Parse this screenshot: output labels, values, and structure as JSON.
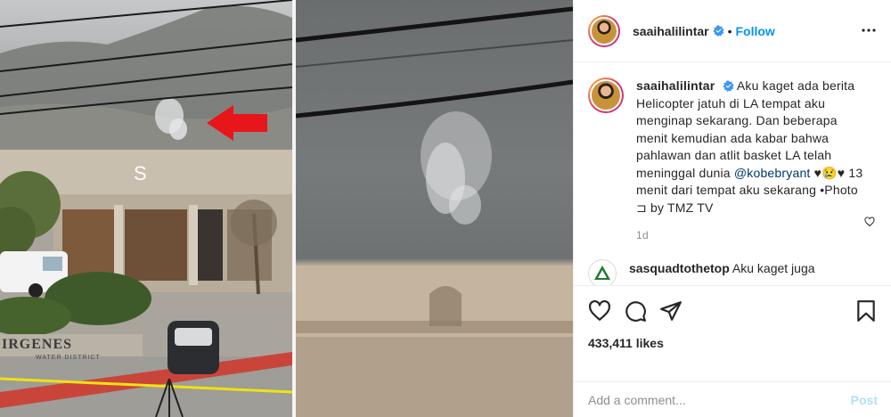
{
  "post": {
    "author": "saaihalilintar",
    "follow_label": "Follow",
    "separator": "•",
    "caption_parts": {
      "text1": "Aku kaget ada berita Helicopter jatuh di LA tempat aku menginap sekarang. Dan beberapa menit kemudian ada kabar bahwa pahlawan dan atlit basket LA telah meninggal dunia ",
      "mention": "@kobebryant",
      "text2": " ♥😢♥ 13 menit dari tempat aku sekarang •Photo ⊐ by TMZ TV"
    },
    "time_ago": "1d",
    "next_comment": {
      "author": "sasquadtothetop",
      "text": "Aku kaget juga"
    },
    "likes": "433,411 likes",
    "comment_placeholder": "Add a comment...",
    "post_label": "Post"
  },
  "photo": {
    "sign_letter": "S",
    "building_text": "IRGENES",
    "building_subtext": "WATER DISTRICT"
  },
  "colors": {
    "accent": "#0095f6",
    "verified": "#3897f0",
    "arrow": "#e8161b",
    "post_disabled": "#b2dffc"
  },
  "icons": {
    "verified": "verified-badge-icon",
    "more": "more-options-icon",
    "like": "heart-icon",
    "comment": "comment-icon",
    "share": "paper-plane-icon",
    "save": "bookmark-icon"
  }
}
